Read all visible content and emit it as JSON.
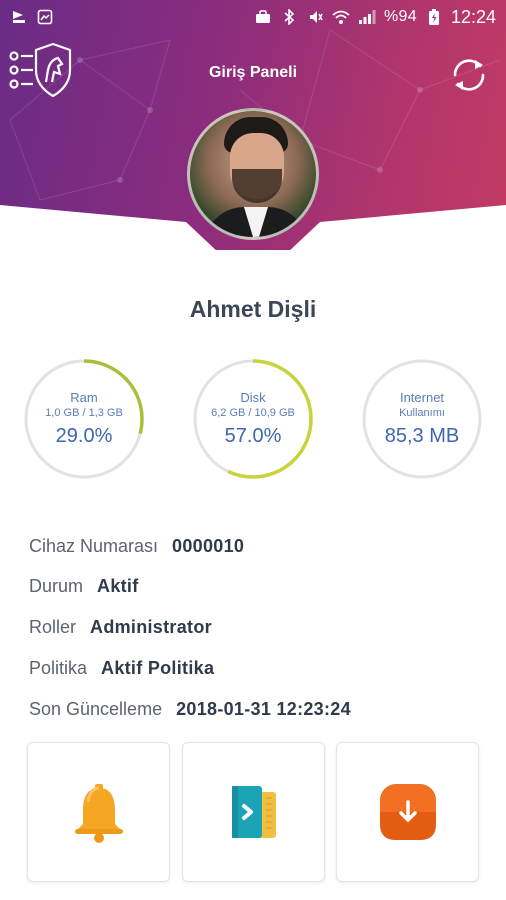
{
  "status_bar": {
    "battery_text": "%94",
    "time": "12:24"
  },
  "app_bar": {
    "title": "Giriş Paneli",
    "left_icon": "menu-shield-horse-icon",
    "right_icon": "refresh-icon"
  },
  "profile": {
    "name": "Ahmet Dişli"
  },
  "gauges": [
    {
      "label": "Ram",
      "sub": "1,0 GB / 1,3 GB",
      "value": "29.0%",
      "percent": 29.0,
      "color": "#a8c13a"
    },
    {
      "label": "Disk",
      "sub": "6,2 GB / 10,9 GB",
      "value": "57.0%",
      "percent": 57.0,
      "color": "#c8d23a"
    },
    {
      "label": "Internet",
      "sub": "Kullanımı",
      "value": "85,3 MB",
      "percent": 0,
      "color": "#a8c13a"
    }
  ],
  "info": {
    "device_label": "Cihaz Numarası",
    "device_value": "0000010",
    "status_label": "Durum",
    "status_value": "Aktif",
    "roles_label": "Roller",
    "roles_value": "Administrator",
    "policy_label": "Politika",
    "policy_value": "Aktif Politika",
    "updated_label": "Son Güncelleme",
    "updated_value": "2018-01-31 12:23:24"
  },
  "actions": [
    {
      "icon": "bell-icon"
    },
    {
      "icon": "document-arrow-icon"
    },
    {
      "icon": "download-icon"
    }
  ],
  "colors": {
    "header_start": "#6a2c86",
    "header_end": "#c23a63",
    "gauge_track": "#dfe3e8",
    "bell": "#f5a623",
    "doc": "#1ba4b6",
    "download": "#f36f21"
  }
}
